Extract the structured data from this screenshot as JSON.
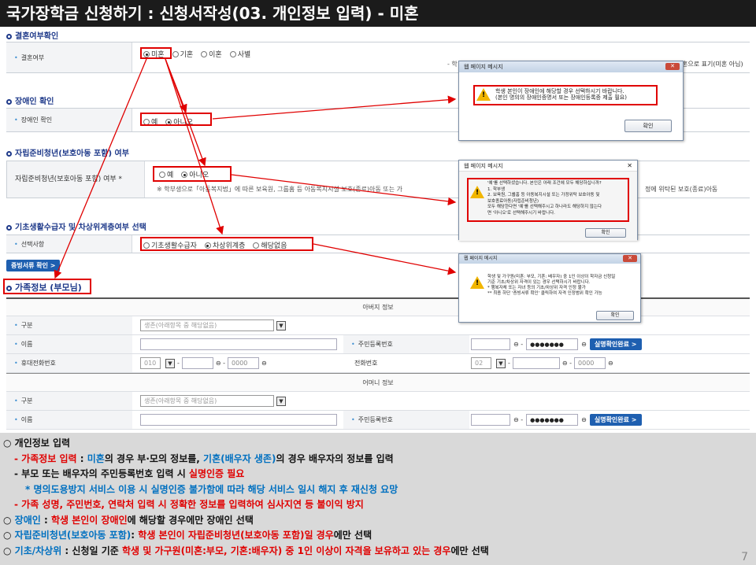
{
  "title": "국가장학금 신청하기 : 신청서작성(03. 개인정보 입력) - 미혼",
  "marriage": {
    "section": "결혼여부확인",
    "label": "결혼여부",
    "options": [
      "미혼",
      "기혼",
      "이혼",
      "사별"
    ],
    "selected": "미혼",
    "note_left": "- 학",
    "note_right": "혼으로 표기(미혼 아님)"
  },
  "disabled": {
    "section": "장애인 확인",
    "label": "장애인 확인",
    "options": [
      "예",
      "아니오"
    ],
    "selected": "아니오"
  },
  "independent": {
    "section": "자립준비청년(보호아동 포함) 여부",
    "label": "자립준비청년(보호아동 포함) 여부 *",
    "options": [
      "예",
      "아니오"
    ],
    "selected": "아니오",
    "note": "※ 학부생으로「아동복지법」에 따른 보육원, 그룹홈 등 아동복지시설 보호(종료)아동 또는 가",
    "note_right": "정에 위탁된 보호(종료)아동"
  },
  "welfare": {
    "section": "기초생활수급자 및 차상위계층여부 선택",
    "label": "선택사항",
    "options": [
      "기초생활수급자",
      "차상위계층",
      "해당없음"
    ],
    "selected": "차상위계층",
    "evidence_button": "증빙서류 확인 >"
  },
  "family": {
    "section": "가족정보 (부모님)",
    "father_header": "아버지 정보",
    "mother_header": "어머니 정보",
    "type_label": "구분",
    "type_value": "생존(아래항목 중 해당없음)",
    "name_label": "이름",
    "rrn_label": "주민등록번호",
    "rrn_mask": "●●●●●●●",
    "verified_button": "실명확인완료 >",
    "mobile_label": "휴대전화번호",
    "mobile_prefix": "010",
    "phone_label": "전화번호",
    "phone_prefix": "02",
    "phone_tail": "0000"
  },
  "dialogs": [
    {
      "title": "웹 페이지 메시지",
      "message": "학생 본인이 장애인에 해당할 경우 선택하시기 바랍니다.\n(본인 명의의 장애인증명서 또는 장애인등록증 제출 필요)",
      "button": "확인"
    },
    {
      "title": "웹 페이지 메시지",
      "message": "'예'를 선택하셨습니다. 본인은 아래 조건에 모두 해당하십니까?\n1. 학부생\n2. 보육원, 그룹홈 등 아동복지시설 또는 가정위탁 보호아동 및\n보호종료아동(자립준비청년)\n모두 해당한다면 '예'를 선택해주시고 하나라도 해당하지 않는다\n면 '아니오'로 선택해주시기 바랍니다.",
      "button": "확인"
    },
    {
      "title": "웹 페이지 메시지",
      "message": "학생 및 가구원(미혼: 부모, 기혼: 배우자) 중 1인 이상이 학자금 신청일\n기준 기초/차상위 자격이 있는 경우 선택하시기 바랍니다.\n* 행복자체 또는 자녀 등의 기초/차상위 자격 인정 불가\n** 최종 하단 '증빙서류 확인' 클릭하여 자격 인정범위 확인 가능",
      "button": "확인"
    }
  ],
  "notes": {
    "heading": "○ 개인정보 입력",
    "l1a": "- 가족정보 입력",
    "l1b": " : ",
    "l1c": "미혼",
    "l1d": "의 경우 부·모의 정보를, ",
    "l1e": "기혼(배우자 생존)",
    "l1f": "의 경우 배우자의 정보를 입력",
    "l2a": "- 부모 또는 배우자의 주민등록번호 입력 시 ",
    "l2b": "실명인증 필요",
    "l3": "* 명의도용방지 서비스 이용 시 실명인증 불가함에 따라 해당 서비스 일시 해지 후 재신청 요망",
    "l4": "- 가족 성명, 주민번호, 연락처 입력 시 정확한 정보를 입력하여 심사지연 등 불이익 방지",
    "l5a": "○ ",
    "l5b": "장애인",
    "l5c": " : ",
    "l5d": "학생 본인이 장애인",
    "l5e": "에 해당할 경우에만 장애인 선택",
    "l6a": "○ ",
    "l6b": "자립준비청년(보호아동 포함)",
    "l6c": ": ",
    "l6d": "학생 본인이 자립준비청년(보호아동 포함)일 경우",
    "l6e": "에만 선택",
    "l7a": "○ ",
    "l7b": "기초/차상위",
    "l7c": " : 신청일 기준 ",
    "l7d": "학생 및 가구원(미혼:부모, 기혼:배우자) 중 1인 이상이 자격을 보유하고 있는 경우",
    "l7e": "에만 선택",
    "page": "7"
  }
}
